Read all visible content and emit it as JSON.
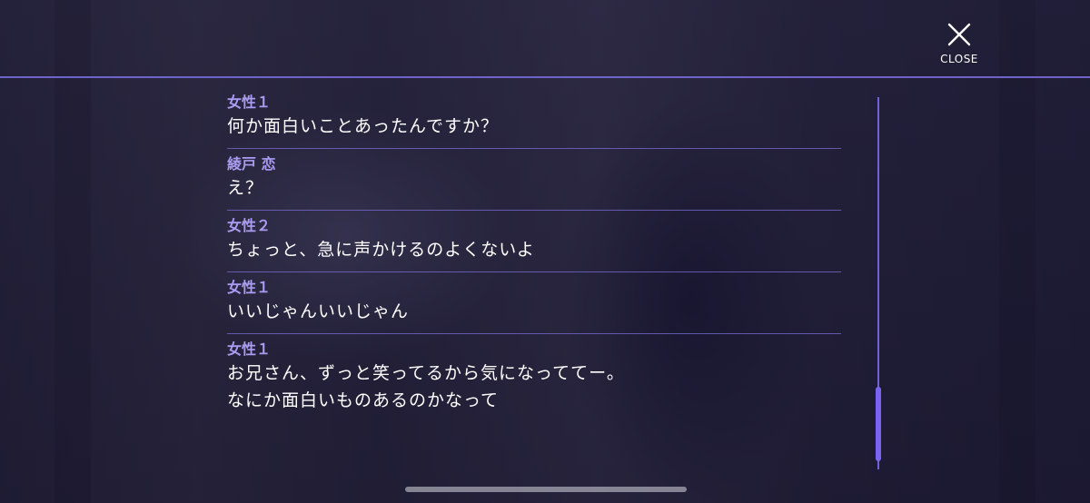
{
  "close": {
    "label": "CLOSE",
    "icon": "close-icon"
  },
  "log": [
    {
      "speaker": "女性１",
      "text": "何か面白いことあったんですか？"
    },
    {
      "speaker": "綾戸 恋",
      "text": "え？"
    },
    {
      "speaker": "女性２",
      "text": "ちょっと、急に声かけるのよくないよ"
    },
    {
      "speaker": "女性１",
      "text": "いいじゃんいいじゃん"
    },
    {
      "speaker": "女性１",
      "text": "お兄さん、ずっと笑ってるから気になっててー。\nなにか面白いものあるのかなって"
    }
  ],
  "colors": {
    "accent": "#6e63c6",
    "speaker": "#a99cf2"
  }
}
